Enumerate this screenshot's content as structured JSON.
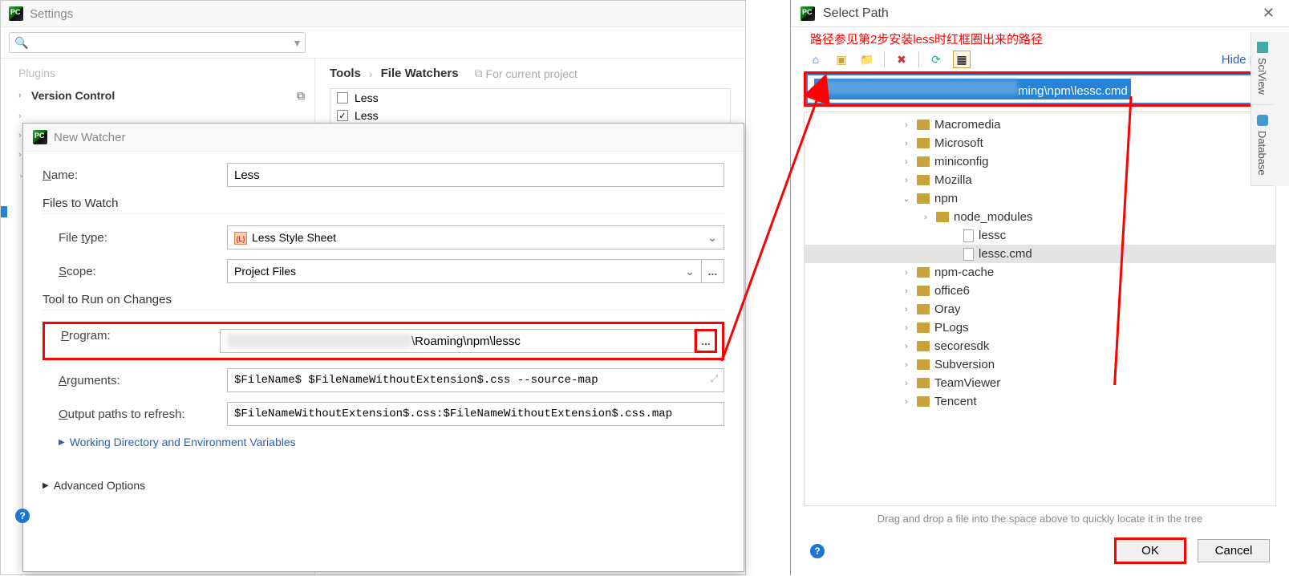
{
  "settings": {
    "title": "Settings",
    "search_placeholder": "",
    "sidebar": {
      "items": [
        {
          "label": "Plugins",
          "dim": true
        },
        {
          "label": "Version Control",
          "bold": true,
          "chev": "›",
          "copy": true
        }
      ]
    },
    "breadcrumb": {
      "main": "Tools",
      "sep": "›",
      "sub": "File Watchers",
      "proj": "For current project"
    },
    "watchers": [
      {
        "checked": false,
        "label": "Less"
      },
      {
        "checked": true,
        "label": "Less"
      }
    ]
  },
  "newWatcher": {
    "title": "New Watcher",
    "nameLabel": "Name:",
    "nameValue": "Less",
    "filesSection": "Files to Watch",
    "fileTypeLabel": "File type:",
    "fileTypeValue": "Less Style Sheet",
    "scopeLabel": "Scope:",
    "scopeValue": "Project Files",
    "toolSection": "Tool to Run on Changes",
    "programLabel": "Program:",
    "programSuffix": "\\Roaming\\npm\\lessc",
    "argsLabel": "Arguments:",
    "argsValue": "$FileName$ $FileNameWithoutExtension$.css --source-map",
    "outLabel": "Output paths to refresh:",
    "outValue": "$FileNameWithoutExtension$.css:$FileNameWithoutExtension$.css.map",
    "wdLink": "Working Directory and Environment Variables",
    "advLink": "Advanced Options",
    "browse": "..."
  },
  "selectPath": {
    "title": "Select Path",
    "annotation": "路径参见第2步安装less时红框圈出来的路径",
    "hidePath": "Hide path",
    "pathSuffix": "ming\\npm\\lessc.cmd",
    "tree": [
      {
        "depth": 1,
        "chev": "›",
        "icon": "folder",
        "label": "Macromedia"
      },
      {
        "depth": 1,
        "chev": "›",
        "icon": "folder",
        "label": "Microsoft"
      },
      {
        "depth": 1,
        "chev": "›",
        "icon": "folder",
        "label": "miniconfig"
      },
      {
        "depth": 1,
        "chev": "›",
        "icon": "folder",
        "label": "Mozilla"
      },
      {
        "depth": 1,
        "chev": "⌄",
        "icon": "folder",
        "label": "npm"
      },
      {
        "depth": 2,
        "chev": "›",
        "icon": "folder",
        "label": "node_modules"
      },
      {
        "depth": 3,
        "chev": "",
        "icon": "file",
        "label": "lessc"
      },
      {
        "depth": 3,
        "chev": "",
        "icon": "file",
        "label": "lessc.cmd",
        "sel": true
      },
      {
        "depth": 1,
        "chev": "›",
        "icon": "folder",
        "label": "npm-cache"
      },
      {
        "depth": 1,
        "chev": "›",
        "icon": "folder",
        "label": "office6"
      },
      {
        "depth": 1,
        "chev": "›",
        "icon": "folder",
        "label": "Oray"
      },
      {
        "depth": 1,
        "chev": "›",
        "icon": "folder",
        "label": "PLogs"
      },
      {
        "depth": 1,
        "chev": "›",
        "icon": "folder",
        "label": "secoresdk"
      },
      {
        "depth": 1,
        "chev": "›",
        "icon": "folder",
        "label": "Subversion"
      },
      {
        "depth": 1,
        "chev": "›",
        "icon": "folder",
        "label": "TeamViewer"
      },
      {
        "depth": 1,
        "chev": "›",
        "icon": "folder",
        "label": "Tencent"
      }
    ],
    "hint": "Drag and drop a file into the space above to quickly locate it in the tree",
    "ok": "OK",
    "cancel": "Cancel"
  },
  "rightTabs": [
    {
      "label": "SciView"
    },
    {
      "label": "Database"
    }
  ]
}
